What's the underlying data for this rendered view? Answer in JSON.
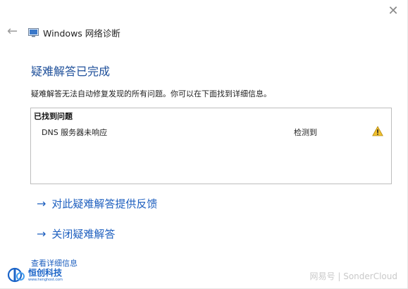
{
  "window": {
    "title": "Windows 网络诊断",
    "close_glyph": "✕",
    "back_glyph": "←"
  },
  "main": {
    "heading": "疑难解答已完成",
    "description": "疑难解答无法自动修复发现的所有问题。你可以在下面找到详细信息。",
    "problems": {
      "header": "已找到问题",
      "rows": [
        {
          "name": "DNS 服务器未响应",
          "status": "检测到",
          "icon": "warning-icon"
        }
      ]
    },
    "links": {
      "feedback": "对此疑难解答提供反馈",
      "close": "关闭疑难解答",
      "arrow_glyph": "→"
    },
    "details_link": "查看详细信息"
  },
  "branding": {
    "logo_text": "恒创科技",
    "logo_url": "www.henghost.com",
    "watermark": "网易号 | SonderCloud"
  },
  "colors": {
    "heading": "#1e4f9a",
    "link": "#1e5fbf",
    "warning": "#f2c12e"
  }
}
